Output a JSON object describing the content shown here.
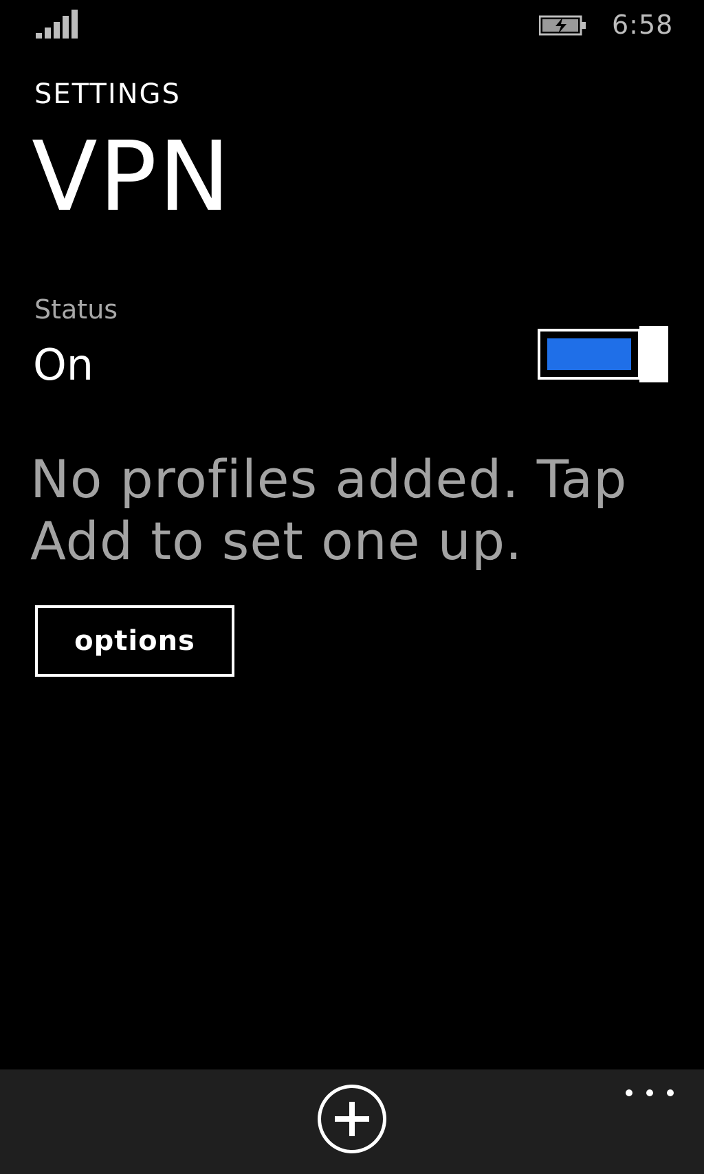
{
  "status_bar": {
    "signal_icon": "signal-strength-icon",
    "battery_icon": "battery-charging-icon",
    "time": "6:58"
  },
  "header": {
    "section": "SETTINGS",
    "title": "VPN"
  },
  "status": {
    "label": "Status",
    "value": "On",
    "toggle_state": "on",
    "toggle_color": "#1f6fe8"
  },
  "empty_message": "No profiles added. Tap Add to set one up.",
  "options_button": {
    "label": "options"
  },
  "app_bar": {
    "add_icon": "add-icon",
    "more_icon": "more-icon",
    "background": "#1f1f1f"
  }
}
